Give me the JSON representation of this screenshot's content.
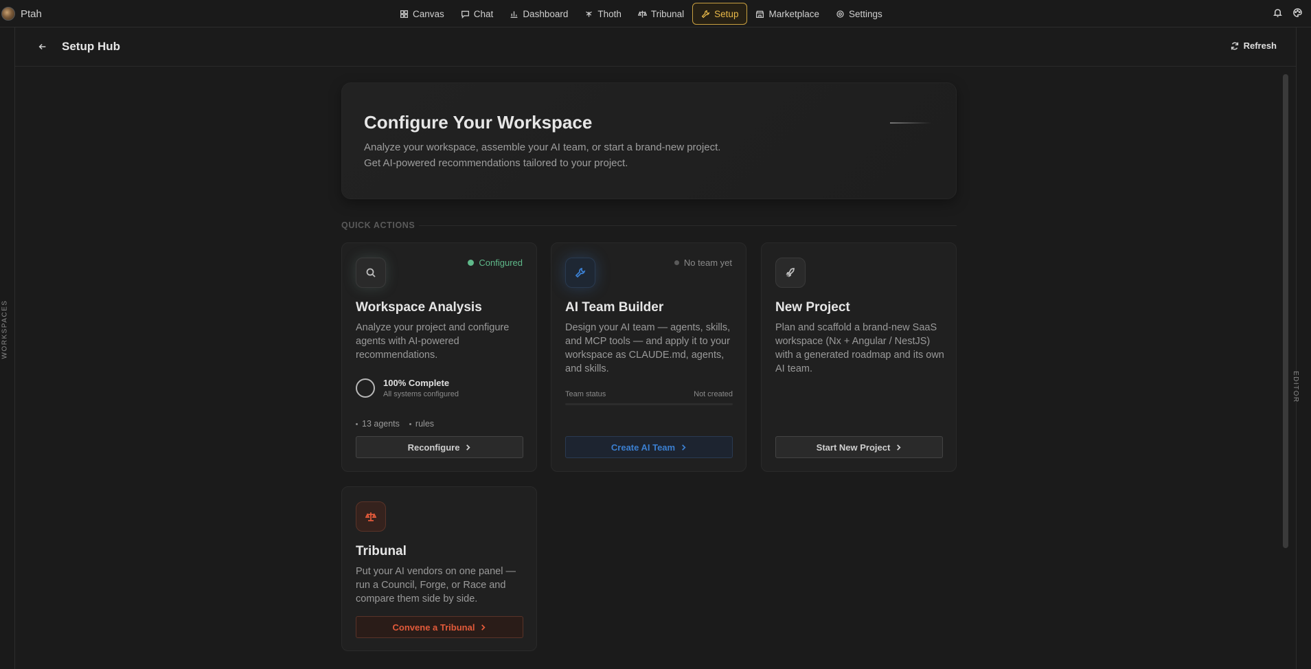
{
  "app": {
    "name": "Ptah"
  },
  "nav": [
    {
      "label": "Canvas",
      "icon": "grid-icon"
    },
    {
      "label": "Chat",
      "icon": "chat-icon"
    },
    {
      "label": "Dashboard",
      "icon": "bar-chart-icon"
    },
    {
      "label": "Thoth",
      "icon": "thoth-icon"
    },
    {
      "label": "Tribunal",
      "icon": "tribunal-icon"
    },
    {
      "label": "Setup",
      "icon": "wrench-icon",
      "active": true
    },
    {
      "label": "Marketplace",
      "icon": "store-icon"
    },
    {
      "label": "Settings",
      "icon": "gear-icon"
    }
  ],
  "rails": {
    "left": "WORKSPACES",
    "right": "EDITOR"
  },
  "header": {
    "title": "Setup Hub",
    "refresh_label": "Refresh"
  },
  "hero": {
    "title": "Configure Your Workspace",
    "description": "Analyze your workspace, assemble your AI team, or start a brand-new project. Get AI-powered recommendations tailored to your project."
  },
  "section": {
    "label": "QUICK ACTIONS"
  },
  "cards": {
    "analysis": {
      "title": "Workspace Analysis",
      "status": "Configured",
      "description": "Analyze your project and configure agents with AI-powered recommendations.",
      "progress_title": "100% Complete",
      "progress_sub": "All systems configured",
      "meta_agents": "13 agents",
      "meta_rules": "rules",
      "button": "Reconfigure"
    },
    "team": {
      "title": "AI Team Builder",
      "status": "No team yet",
      "description": "Design your AI team — agents, skills, and MCP tools — and apply it to your workspace as CLAUDE.md, agents, and skills.",
      "team_status_label": "Team status",
      "team_status_value": "Not created",
      "button": "Create AI Team"
    },
    "project": {
      "title": "New Project",
      "description": "Plan and scaffold a brand-new SaaS workspace (Nx + Angular / NestJS) with a generated roadmap and its own AI team.",
      "button": "Start New Project"
    },
    "tribunal": {
      "title": "Tribunal",
      "description": "Put your AI vendors on one panel — run a Council, Forge, or Race and compare them side by side.",
      "button": "Convene a Tribunal"
    }
  },
  "colors": {
    "accent": "#e9b949",
    "configured": "#5fb98a",
    "team_blue": "#3b7fd0",
    "tribunal_red": "#e25a3a"
  }
}
